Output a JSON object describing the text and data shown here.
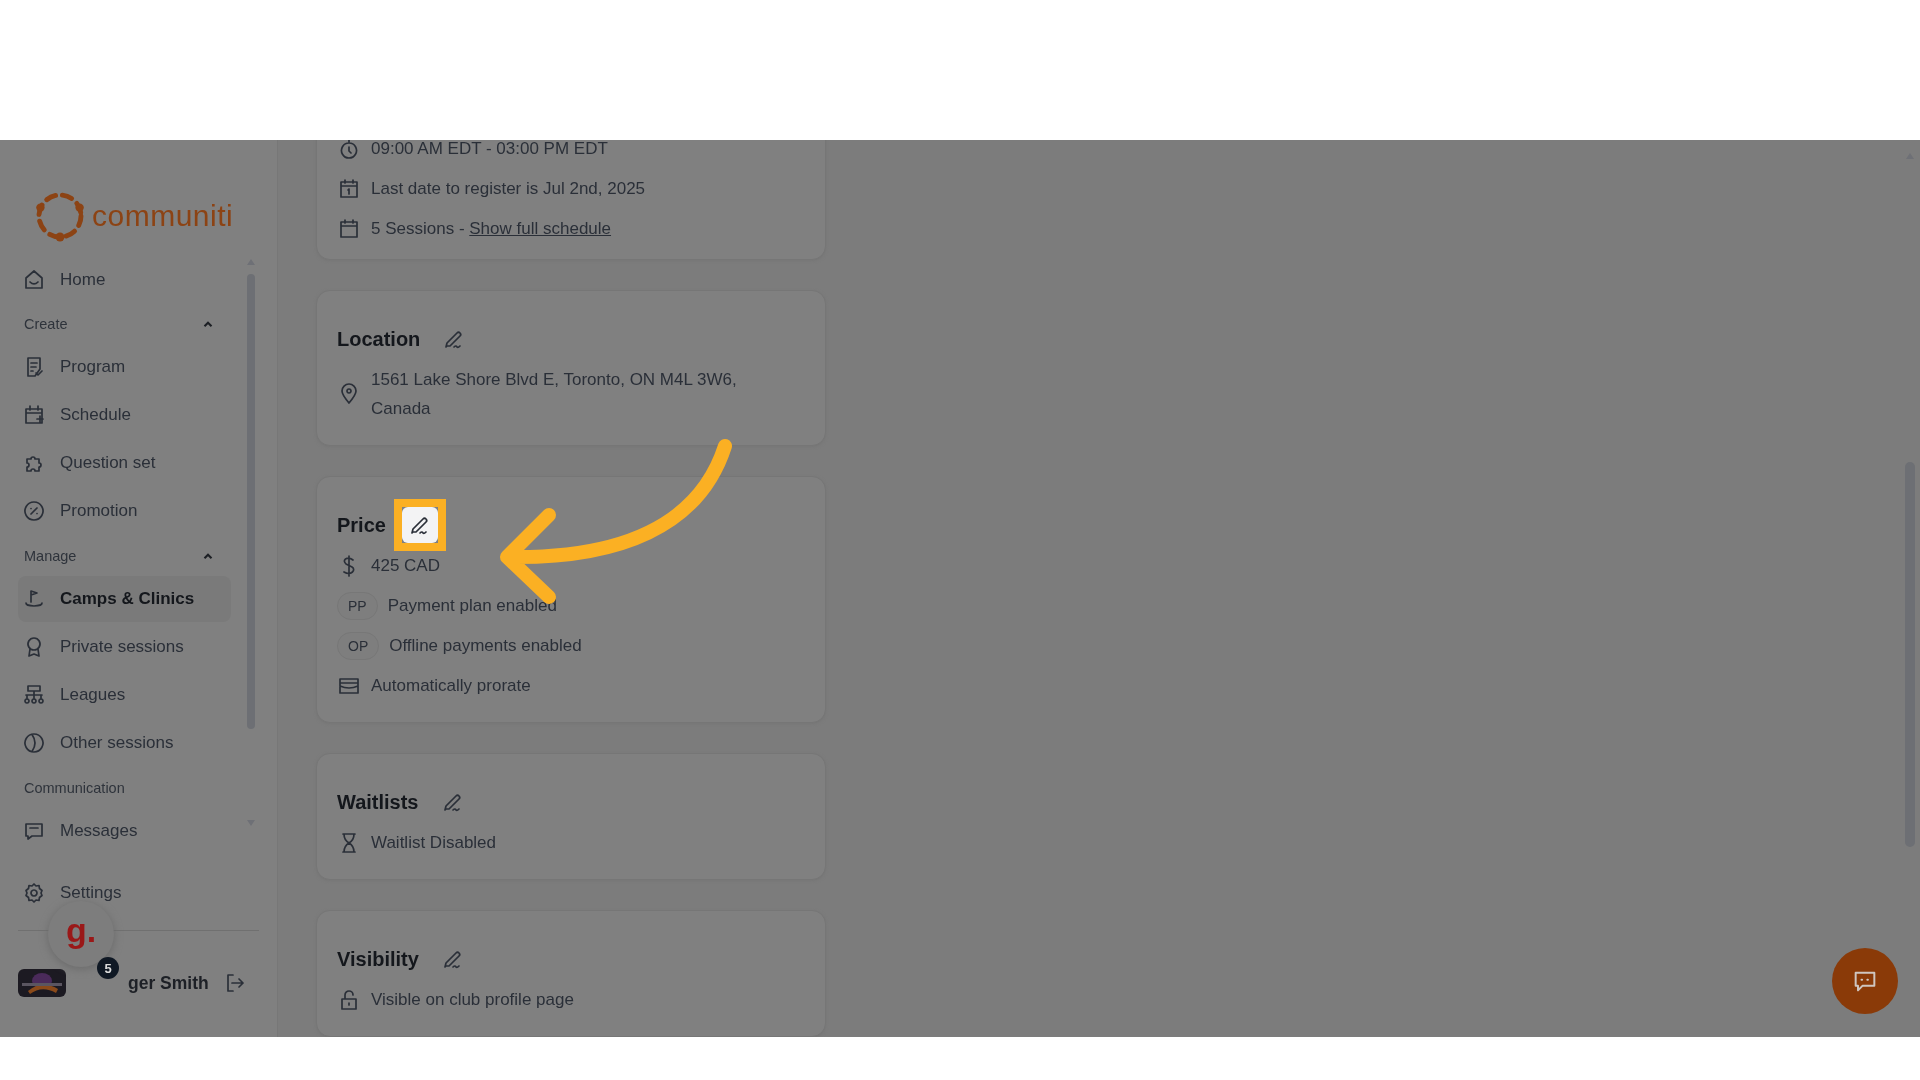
{
  "logo": {
    "text": "communiti"
  },
  "sidebar": {
    "home": {
      "label": "Home",
      "selected": false
    },
    "groups": [
      {
        "label": "Create",
        "expanded": true,
        "items": [
          {
            "label": "Program",
            "selected": false
          },
          {
            "label": "Schedule",
            "selected": false
          },
          {
            "label": "Question set",
            "selected": false
          },
          {
            "label": "Promotion",
            "selected": false
          }
        ]
      },
      {
        "label": "Manage",
        "expanded": true,
        "items": [
          {
            "label": "Camps & Clinics",
            "selected": true
          },
          {
            "label": "Private sessions",
            "selected": false
          },
          {
            "label": "Leagues",
            "selected": false
          },
          {
            "label": "Other sessions",
            "selected": false
          }
        ]
      },
      {
        "label": "Communication",
        "items": [
          {
            "label": "Messages",
            "selected": false
          }
        ]
      }
    ],
    "settings": "Settings",
    "user": "ger Smith"
  },
  "assistant_bubble": {
    "text": "g.",
    "badge": "5"
  },
  "cards": [
    {
      "rows": [
        {
          "kind": "time",
          "text": "09:00 AM EDT - 03:00 PM EDT"
        },
        {
          "kind": "deadline",
          "text": "Last date to register is Jul 2nd, 2025"
        },
        {
          "kind": "sessions",
          "text": "5 Sessions - ",
          "link": "Show full schedule"
        }
      ]
    },
    {
      "title": "Location",
      "highlighted": false,
      "rows": [
        {
          "kind": "address",
          "text": "1561 Lake Shore Blvd E, Toronto, ON M4L 3W6, Canada"
        }
      ]
    },
    {
      "title": "Price",
      "highlighted": true,
      "rows": [
        {
          "kind": "amount",
          "text": "425 CAD"
        },
        {
          "kind": "tag",
          "tag": "PP",
          "text": "Payment plan enabled"
        },
        {
          "kind": "tag",
          "tag": "OP",
          "text": "Offline payments enabled"
        },
        {
          "kind": "prorate",
          "text": "Automatically prorate"
        }
      ]
    },
    {
      "title": "Waitlists",
      "highlighted": false,
      "rows": [
        {
          "kind": "waitlist",
          "text": "Waitlist Disabled"
        }
      ]
    },
    {
      "title": "Visibility",
      "highlighted": false,
      "rows": [
        {
          "kind": "visibility",
          "text": "Visible on club profile page"
        }
      ]
    }
  ]
}
